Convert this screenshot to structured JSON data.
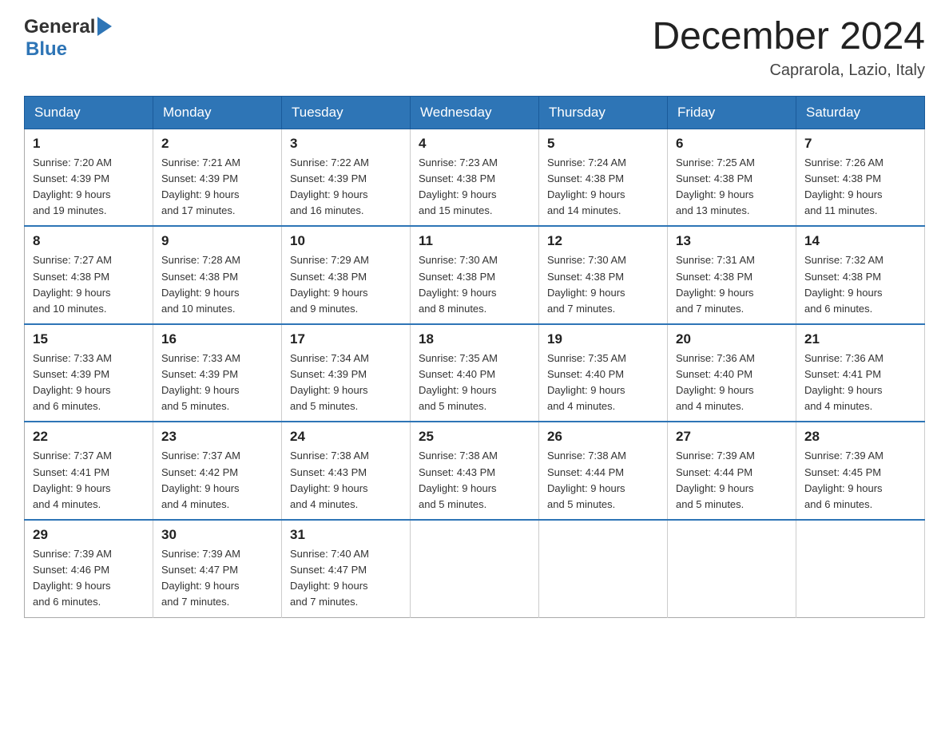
{
  "header": {
    "logo_general": "General",
    "logo_blue": "Blue",
    "month_title": "December 2024",
    "location": "Caprarola, Lazio, Italy"
  },
  "days_of_week": [
    "Sunday",
    "Monday",
    "Tuesday",
    "Wednesday",
    "Thursday",
    "Friday",
    "Saturday"
  ],
  "weeks": [
    [
      {
        "day": "1",
        "sunrise": "7:20 AM",
        "sunset": "4:39 PM",
        "daylight": "9 hours and 19 minutes."
      },
      {
        "day": "2",
        "sunrise": "7:21 AM",
        "sunset": "4:39 PM",
        "daylight": "9 hours and 17 minutes."
      },
      {
        "day": "3",
        "sunrise": "7:22 AM",
        "sunset": "4:39 PM",
        "daylight": "9 hours and 16 minutes."
      },
      {
        "day": "4",
        "sunrise": "7:23 AM",
        "sunset": "4:38 PM",
        "daylight": "9 hours and 15 minutes."
      },
      {
        "day": "5",
        "sunrise": "7:24 AM",
        "sunset": "4:38 PM",
        "daylight": "9 hours and 14 minutes."
      },
      {
        "day": "6",
        "sunrise": "7:25 AM",
        "sunset": "4:38 PM",
        "daylight": "9 hours and 13 minutes."
      },
      {
        "day": "7",
        "sunrise": "7:26 AM",
        "sunset": "4:38 PM",
        "daylight": "9 hours and 11 minutes."
      }
    ],
    [
      {
        "day": "8",
        "sunrise": "7:27 AM",
        "sunset": "4:38 PM",
        "daylight": "9 hours and 10 minutes."
      },
      {
        "day": "9",
        "sunrise": "7:28 AM",
        "sunset": "4:38 PM",
        "daylight": "9 hours and 10 minutes."
      },
      {
        "day": "10",
        "sunrise": "7:29 AM",
        "sunset": "4:38 PM",
        "daylight": "9 hours and 9 minutes."
      },
      {
        "day": "11",
        "sunrise": "7:30 AM",
        "sunset": "4:38 PM",
        "daylight": "9 hours and 8 minutes."
      },
      {
        "day": "12",
        "sunrise": "7:30 AM",
        "sunset": "4:38 PM",
        "daylight": "9 hours and 7 minutes."
      },
      {
        "day": "13",
        "sunrise": "7:31 AM",
        "sunset": "4:38 PM",
        "daylight": "9 hours and 7 minutes."
      },
      {
        "day": "14",
        "sunrise": "7:32 AM",
        "sunset": "4:38 PM",
        "daylight": "9 hours and 6 minutes."
      }
    ],
    [
      {
        "day": "15",
        "sunrise": "7:33 AM",
        "sunset": "4:39 PM",
        "daylight": "9 hours and 6 minutes."
      },
      {
        "day": "16",
        "sunrise": "7:33 AM",
        "sunset": "4:39 PM",
        "daylight": "9 hours and 5 minutes."
      },
      {
        "day": "17",
        "sunrise": "7:34 AM",
        "sunset": "4:39 PM",
        "daylight": "9 hours and 5 minutes."
      },
      {
        "day": "18",
        "sunrise": "7:35 AM",
        "sunset": "4:40 PM",
        "daylight": "9 hours and 5 minutes."
      },
      {
        "day": "19",
        "sunrise": "7:35 AM",
        "sunset": "4:40 PM",
        "daylight": "9 hours and 4 minutes."
      },
      {
        "day": "20",
        "sunrise": "7:36 AM",
        "sunset": "4:40 PM",
        "daylight": "9 hours and 4 minutes."
      },
      {
        "day": "21",
        "sunrise": "7:36 AM",
        "sunset": "4:41 PM",
        "daylight": "9 hours and 4 minutes."
      }
    ],
    [
      {
        "day": "22",
        "sunrise": "7:37 AM",
        "sunset": "4:41 PM",
        "daylight": "9 hours and 4 minutes."
      },
      {
        "day": "23",
        "sunrise": "7:37 AM",
        "sunset": "4:42 PM",
        "daylight": "9 hours and 4 minutes."
      },
      {
        "day": "24",
        "sunrise": "7:38 AM",
        "sunset": "4:43 PM",
        "daylight": "9 hours and 4 minutes."
      },
      {
        "day": "25",
        "sunrise": "7:38 AM",
        "sunset": "4:43 PM",
        "daylight": "9 hours and 5 minutes."
      },
      {
        "day": "26",
        "sunrise": "7:38 AM",
        "sunset": "4:44 PM",
        "daylight": "9 hours and 5 minutes."
      },
      {
        "day": "27",
        "sunrise": "7:39 AM",
        "sunset": "4:44 PM",
        "daylight": "9 hours and 5 minutes."
      },
      {
        "day": "28",
        "sunrise": "7:39 AM",
        "sunset": "4:45 PM",
        "daylight": "9 hours and 6 minutes."
      }
    ],
    [
      {
        "day": "29",
        "sunrise": "7:39 AM",
        "sunset": "4:46 PM",
        "daylight": "9 hours and 6 minutes."
      },
      {
        "day": "30",
        "sunrise": "7:39 AM",
        "sunset": "4:47 PM",
        "daylight": "9 hours and 7 minutes."
      },
      {
        "day": "31",
        "sunrise": "7:40 AM",
        "sunset": "4:47 PM",
        "daylight": "9 hours and 7 minutes."
      },
      null,
      null,
      null,
      null
    ]
  ],
  "labels": {
    "sunrise": "Sunrise:",
    "sunset": "Sunset:",
    "daylight": "Daylight:"
  }
}
